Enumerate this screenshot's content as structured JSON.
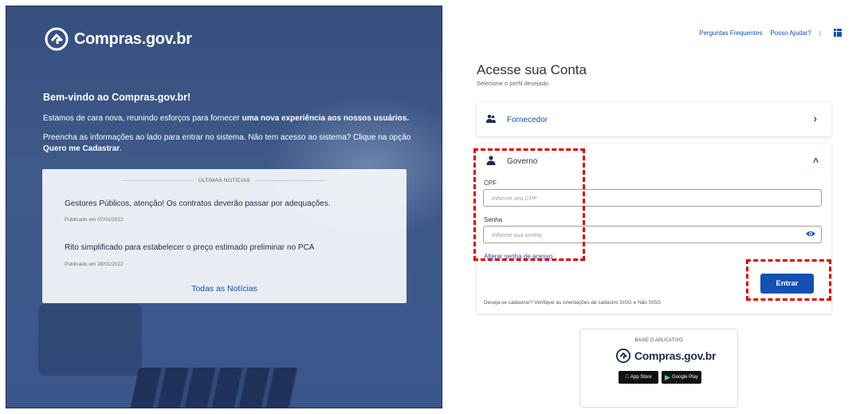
{
  "brand": {
    "name": "Compras.gov.br"
  },
  "welcome": {
    "title": "Bem-vindo ao Compras.gov.br!",
    "p1_start": "Estamos de cara nova, reunindo esforços para fornecer ",
    "p1_bold": "uma nova experiência aos nossos usuários.",
    "p2_start": "Preencha as informações ao lado para entrar no sistema. Não tem acesso ao sistema? Clique na opção ",
    "p2_bold": "Quero me Cadastrar",
    "p2_end": "."
  },
  "news": {
    "header": "ÚLTIMAS NOTÍCIAS",
    "items": [
      {
        "title": "Gestores Públicos, atenção! Os contratos deverão passar por adequações.",
        "date": "Publicado em 07/02/2022"
      },
      {
        "title": "Rito simplificado para estabelecer o preço estimado preliminar no PCA",
        "date": "Publicado em 28/01/2022"
      }
    ],
    "all_link": "Todas as Notícias"
  },
  "top_links": {
    "faq": "Perguntas Frequentes",
    "help": "Posso Ajudar?",
    "sep": "|"
  },
  "account": {
    "title": "Acesse sua Conta",
    "subtitle": "Selecione o perfil desejado"
  },
  "profiles": {
    "fornecedor": {
      "label": "Fornecedor"
    },
    "governo": {
      "label": "Governo",
      "cpf_label": "CPF",
      "cpf_placeholder": "Informe seu CPF",
      "senha_label": "Senha",
      "senha_placeholder": "Informe sua senha",
      "alter_link": "Alterar senha de acesso",
      "submit": "Entrar",
      "cadastro_text": "Deseja se cadastrar? Verifique as orientações de cadastro SISG e Não SISG"
    }
  },
  "app": {
    "header": "BAIXE O APLICATIVO",
    "name": "Compras.gov.br",
    "app_store": "App Store",
    "google_play": "Google Play"
  },
  "colors": {
    "primary": "#1351b4",
    "highlight": "#e00000",
    "left_bg": "#3f5f96"
  }
}
